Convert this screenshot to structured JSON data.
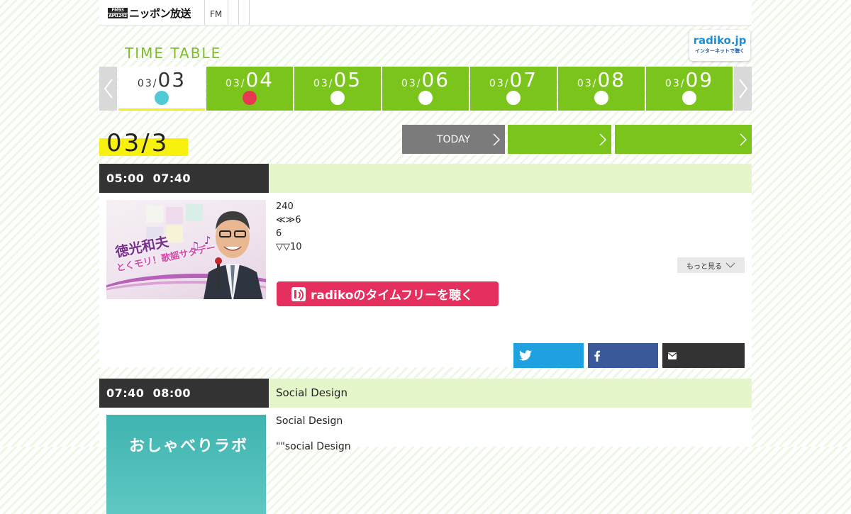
{
  "header": {
    "logo_mark_top": "FM93",
    "logo_mark_bottom": "AM1242",
    "logo_name": "ニッポン放送",
    "nav_fm": "FM"
  },
  "timetable": {
    "title": "TIME TABLE",
    "radiko_badge_title": "radiko.jp",
    "radiko_badge_sub": "インターネットで聴く"
  },
  "days": [
    {
      "month": "03/",
      "day": "03",
      "active": true
    },
    {
      "month": "03/",
      "day": "04",
      "active": false
    },
    {
      "month": "03/",
      "day": "05",
      "active": false
    },
    {
      "month": "03/",
      "day": "06",
      "active": false
    },
    {
      "month": "03/",
      "day": "07",
      "active": false
    },
    {
      "month": "03/",
      "day": "08",
      "active": false
    },
    {
      "month": "03/",
      "day": "09",
      "active": false
    }
  ],
  "current_date": "03/3",
  "nav_buttons": {
    "today": "TODAY"
  },
  "programs": [
    {
      "time_start": "05:00",
      "time_end": "07:40",
      "title": "",
      "thumb_title_1": "徳光和夫",
      "thumb_title_2": "とくモリ！歌謡サタデー",
      "desc_lines": [
        "240",
        "≪≫6",
        "6",
        "▽▽10"
      ],
      "more_label": "もっと見る",
      "radiko_label": "radikoのタイムフリーを聴く"
    },
    {
      "time_start": "07:40",
      "time_end": "08:00",
      "title": "Social Design",
      "thumb_title": "おしゃべりラボ",
      "desc_lines": [
        "Social Design",
        "\"\"social Design"
      ]
    }
  ],
  "colors": {
    "accent_green": "#7ac41c",
    "today_dot": "#4ecbd4",
    "marker_dot": "#e8384f",
    "highlight_yellow": "#f7f10d",
    "radiko_pink": "#e5305f",
    "twitter_blue": "#1ea1de",
    "facebook_blue": "#395998"
  },
  "icons": {
    "prev": "chevron-left-icon",
    "next": "chevron-right-icon",
    "twitter": "twitter-icon",
    "facebook": "facebook-icon",
    "mail": "mail-icon",
    "radiko": "radiko-icon"
  }
}
